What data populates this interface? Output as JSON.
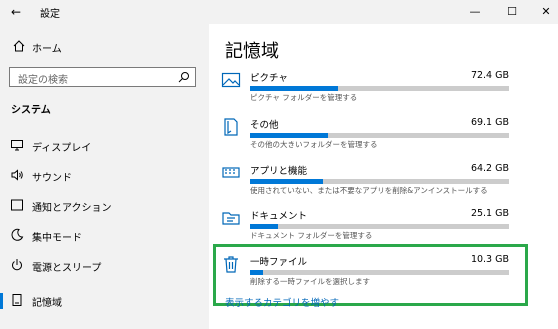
{
  "window": {
    "title": "設定",
    "back": "←",
    "minimize": "—",
    "maximize": "☐",
    "close": "✕"
  },
  "sidebar": {
    "home": "ホーム",
    "search_placeholder": "設定の検索",
    "section": "システム",
    "items": [
      {
        "label": "ディスプレイ",
        "icon": "monitor-icon"
      },
      {
        "label": "サウンド",
        "icon": "speaker-icon"
      },
      {
        "label": "通知とアクション",
        "icon": "notification-icon"
      },
      {
        "label": "集中モード",
        "icon": "moon-icon"
      },
      {
        "label": "電源とスリープ",
        "icon": "power-icon"
      },
      {
        "label": "記憶域",
        "icon": "storage-icon",
        "active": true
      }
    ]
  },
  "main": {
    "title": "記憶域",
    "categories": [
      {
        "name": "ピクチャ",
        "size": "72.4 GB",
        "desc": "ピクチャ フォルダーを管理する",
        "fill": 0.34,
        "icon": "picture-icon"
      },
      {
        "name": "その他",
        "size": "69.1 GB",
        "desc": "その他の大きいフォルダーを管理する",
        "fill": 0.3,
        "icon": "folder-icon"
      },
      {
        "name": "アプリと機能",
        "size": "64.2 GB",
        "desc": "使用されていない、または不要なアプリを削除&アンインストールする",
        "fill": 0.28,
        "icon": "apps-icon"
      },
      {
        "name": "ドキュメント",
        "size": "25.1 GB",
        "desc": "ドキュメント フォルダーを管理する",
        "fill": 0.11,
        "icon": "document-folder-icon"
      },
      {
        "name": "一時ファイル",
        "size": "10.3 GB",
        "desc": "削除する一時ファイルを選択します",
        "fill": 0.05,
        "icon": "trash-icon"
      }
    ],
    "more_link": "表示するカテゴリを増やす"
  },
  "colors": {
    "accent": "#0078d7",
    "highlight": "#2aa84a",
    "sidebar_bg": "#f2f2f2",
    "track": "#cccccc"
  }
}
